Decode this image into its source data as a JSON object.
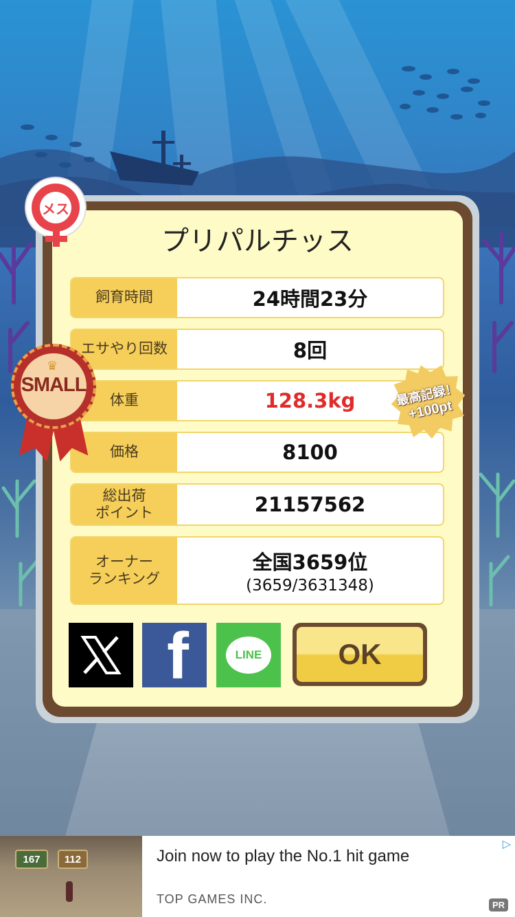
{
  "pet": {
    "name": "プリパルチッス",
    "gender_badge": "メス",
    "size_badge": "SMALL",
    "record_badge": {
      "line1": "最高記録！",
      "line2": "+100pt"
    }
  },
  "stats": [
    {
      "label": "飼育時間",
      "value": "24時間23分"
    },
    {
      "label": "エサやり回数",
      "value": "8回"
    },
    {
      "label": "体重",
      "value": "128.3kg"
    },
    {
      "label": "価格",
      "value": "8100"
    },
    {
      "label": "総出荷\nポイント",
      "value": "21157562"
    },
    {
      "label": "オーナー\nランキング",
      "value": "全国3659位",
      "sub": "(3659/3631348)"
    }
  ],
  "buttons": {
    "x": "X",
    "facebook": "f",
    "line": "LINE",
    "ok": "OK"
  },
  "ad": {
    "title": "Join now to play the No.1 hit game",
    "company": "TOP GAMES INC.",
    "pr": "PR",
    "thumb_left": "167",
    "thumb_right": "112"
  },
  "colors": {
    "weight_value": "#e12b2b",
    "label_bg": "#f5cf59",
    "card_frame": "#6b4a30",
    "card_bg": "#fffbc6"
  }
}
